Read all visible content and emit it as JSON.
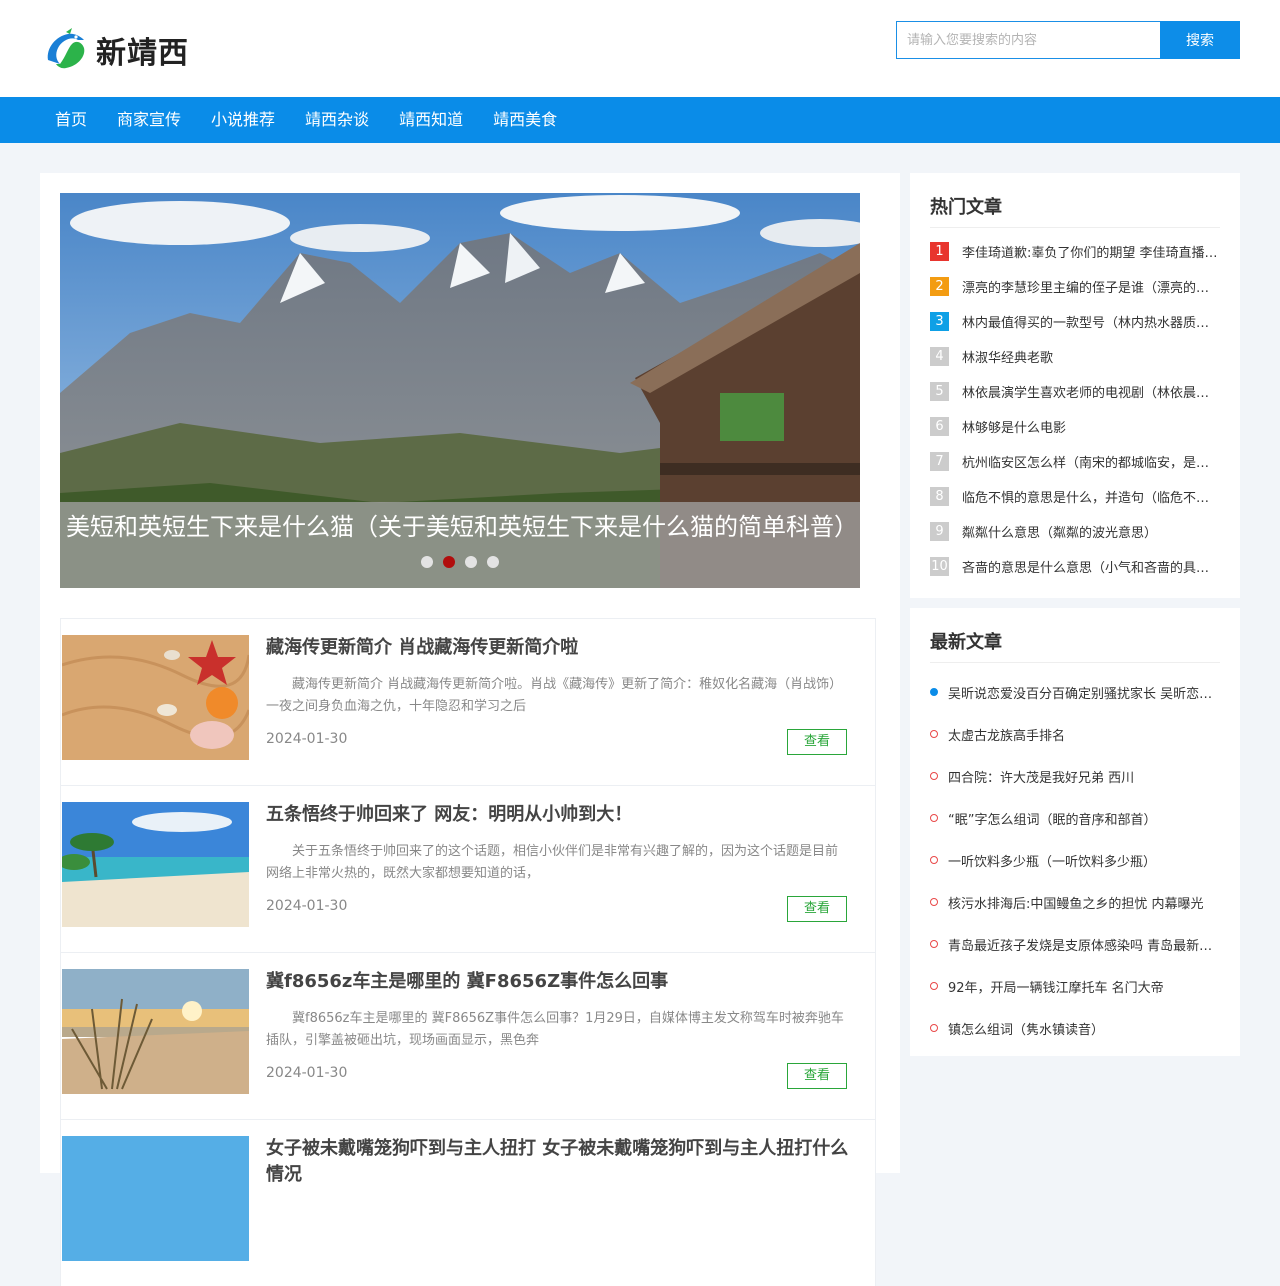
{
  "site": {
    "logo_text": "新靖西"
  },
  "search": {
    "placeholder": "请输入您要搜索的内容",
    "button_label": "搜索"
  },
  "nav": {
    "items": [
      "首页",
      "商家宣传",
      "小说推荐",
      "靖西杂谈",
      "靖西知道",
      "靖西美食"
    ]
  },
  "slider": {
    "caption": "美短和英短生下来是什么猫（关于美短和英短生下来是什么猫的简单科普）",
    "dots": 4,
    "active_dot": 1
  },
  "articles": [
    {
      "title": "藏海传更新简介 肖战藏海传更新简介啦",
      "desc": "藏海传更新简介 肖战藏海传更新简介啦。肖战《藏海传》更新了简介：稚奴化名藏海（肖战饰）一夜之间身负血海之仇，十年隐忍和学习之后",
      "date": "2024-01-30",
      "view_label": "查看"
    },
    {
      "title": "五条悟终于帅回来了 网友：明明从小帅到大！",
      "desc": "关于五条悟终于帅回来了的这个话题，相信小伙伴们是非常有兴趣了解的，因为这个话题是目前网络上非常火热的，既然大家都想要知道的话，",
      "date": "2024-01-30",
      "view_label": "查看"
    },
    {
      "title": "冀f8656z车主是哪里的 冀F8656Z事件怎么回事",
      "desc": "冀f8656z车主是哪里的 冀F8656Z事件怎么回事？1月29日，自媒体博主发文称驾车时被奔驰车插队，引擎盖被砸出坑，现场画面显示，黑色奔",
      "date": "2024-01-30",
      "view_label": "查看"
    },
    {
      "title": "女子被未戴嘴笼狗吓到与主人扭打 女子被未戴嘴笼狗吓到与主人扭打什么情况",
      "desc": "",
      "date": "",
      "view_label": ""
    }
  ],
  "hot": {
    "title": "热门文章",
    "colors": [
      "#e8352e",
      "#f39c12",
      "#0ea0e6",
      "#cccccc"
    ],
    "items": [
      {
        "rank": "1",
        "text": "李佳琦道歉:辜负了你们的期望 李佳琦直播间道歉"
      },
      {
        "rank": "2",
        "text": "漂亮的李慧珍里主编的侄子是谁（漂亮的李慧珍）"
      },
      {
        "rank": "3",
        "text": "林内最值得买的一款型号（林内热水器质量怎么样）"
      },
      {
        "rank": "4",
        "text": "林淑华经典老歌"
      },
      {
        "rank": "5",
        "text": "林依晨演学生喜欢老师的电视剧（林依晨和谁的剧）"
      },
      {
        "rank": "6",
        "text": "林够够是什么电影"
      },
      {
        "rank": "7",
        "text": "杭州临安区怎么样（南宋的都城临安，是现在的哪里）"
      },
      {
        "rank": "8",
        "text": "临危不惧的意思是什么，并造句（临危不惧的意思）"
      },
      {
        "rank": "9",
        "text": "粼粼什么意思（粼粼的波光意思）"
      },
      {
        "rank": "10",
        "text": "吝啬的意思是什么意思（小气和吝啬的具体区别）"
      }
    ]
  },
  "latest": {
    "title": "最新文章",
    "items": [
      "吴昕说恋爱没百分百确定别骚扰家长 吴昕恋爱观",
      "太虚古龙族高手排名",
      "四合院：许大茂是我好兄弟 西川",
      "“眠”字怎么组词（眠的音序和部首）",
      "一听饮料多少瓶（一听饮料多少瓶）",
      "核污水排海后:中国鳗鱼之乡的担忧 内幕曝光",
      "青岛最近孩子发烧是支原体感染吗 青岛最新消息",
      "92年，开局一辆钱江摩托车 名门大帝",
      "镇怎么组词（隽水镇读音）"
    ]
  }
}
